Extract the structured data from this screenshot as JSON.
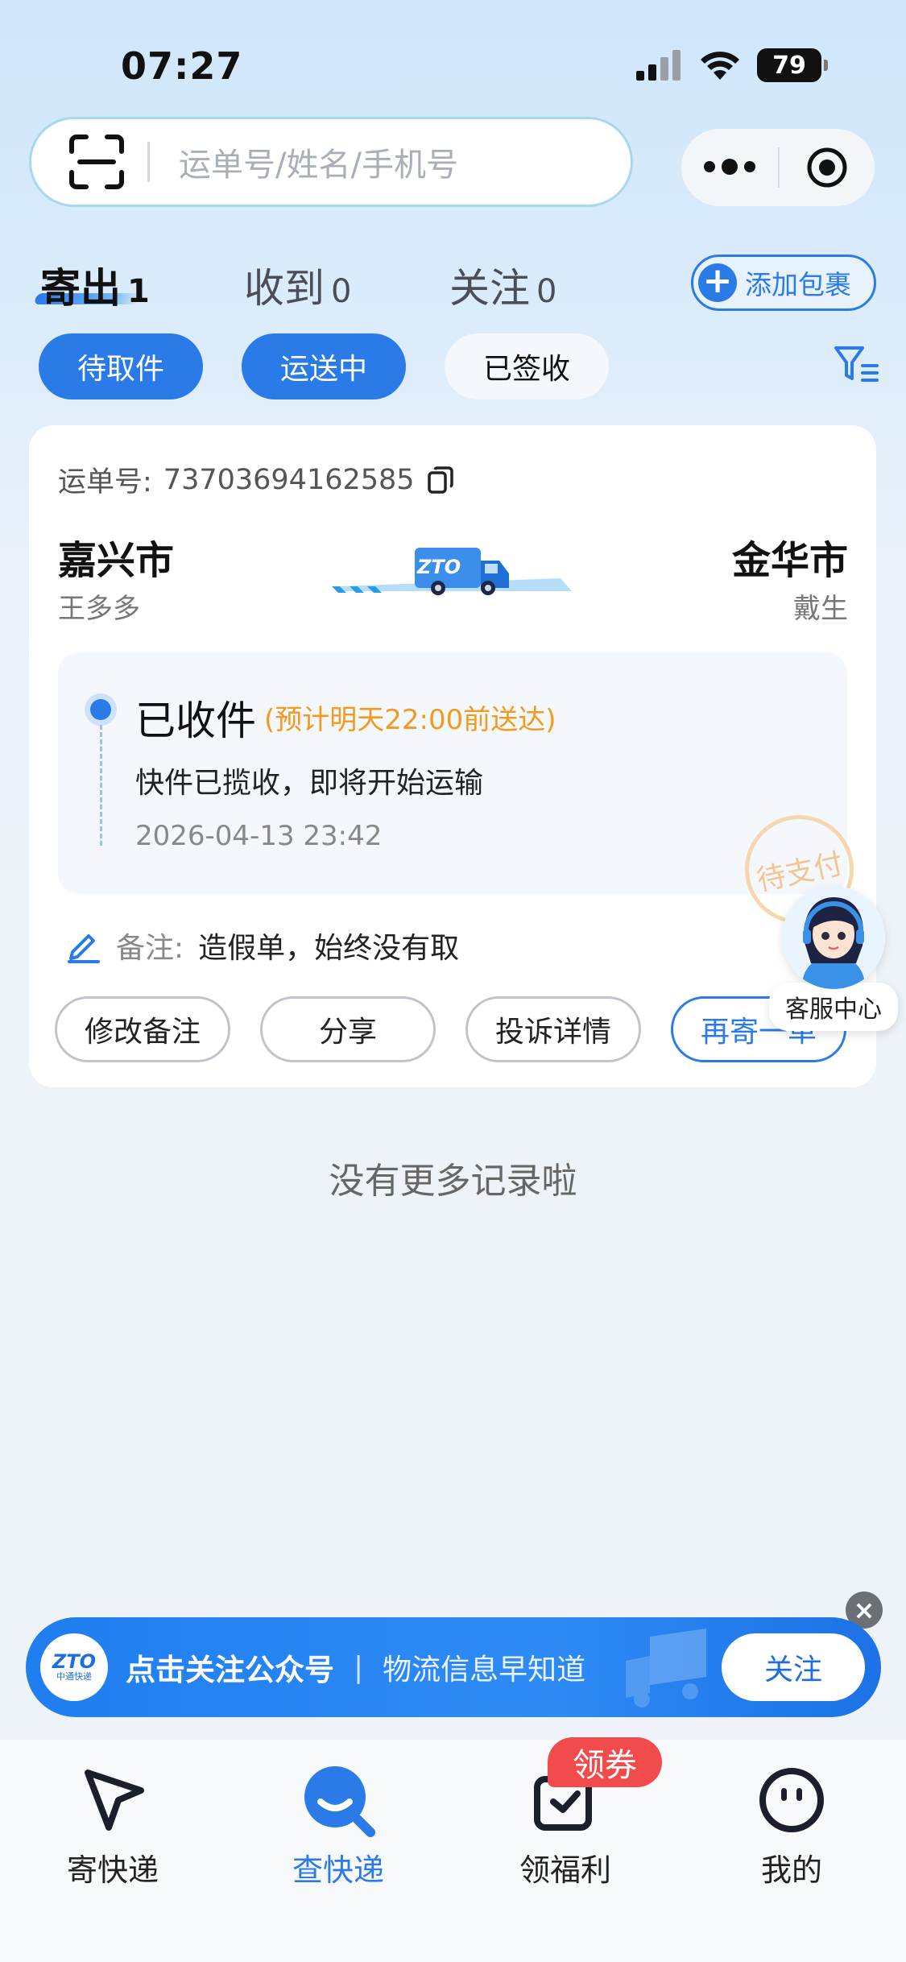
{
  "status_bar": {
    "time": "07:27",
    "battery": "79"
  },
  "search": {
    "placeholder": "运单号/姓名/手机号"
  },
  "tabs": [
    {
      "label": "寄出",
      "count": "1",
      "active": true
    },
    {
      "label": "收到",
      "count": "0",
      "active": false
    },
    {
      "label": "关注",
      "count": "0",
      "active": false
    }
  ],
  "add_package_label": "添加包裹",
  "filters": [
    {
      "label": "待取件",
      "selected": true
    },
    {
      "label": "运送中",
      "selected": true
    },
    {
      "label": "已签收",
      "selected": false
    }
  ],
  "shipment": {
    "waybill_label": "运单号:",
    "waybill_number": "73703694162585",
    "from_city": "嘉兴市",
    "from_name": "王多多",
    "to_city": "金华市",
    "to_name": "戴生",
    "truck_logo": "ZTO",
    "status_title": "已收件",
    "status_eta": "(预计明天22:00前送达)",
    "status_desc": "快件已揽收，即将开始运输",
    "status_time": "2026-04-13 23:42",
    "stamp_text": "待支付",
    "remark_label": "备注:",
    "remark_value": "造假单，始终没有取",
    "actions": [
      "修改备注",
      "分享",
      "投诉详情",
      "再寄一单"
    ]
  },
  "customer_service_label": "客服中心",
  "no_more_text": "没有更多记录啦",
  "banner": {
    "logo_text": "ZTO",
    "logo_sub": "中通快递",
    "title": "点击关注公众号",
    "separator": "|",
    "subtitle": "物流信息早知道",
    "follow_label": "关注"
  },
  "tabbar": [
    {
      "label": "寄快递",
      "icon": "send-icon",
      "active": false
    },
    {
      "label": "查快递",
      "icon": "track-icon",
      "active": true
    },
    {
      "label": "领福利",
      "icon": "gift-icon",
      "active": false
    },
    {
      "label": "我的",
      "icon": "profile-icon",
      "active": false
    }
  ],
  "coupon_badge": "领券",
  "colors": {
    "primary": "#2a7be8",
    "eta_orange": "#f39a1e",
    "badge_red": "#f24b4b"
  }
}
